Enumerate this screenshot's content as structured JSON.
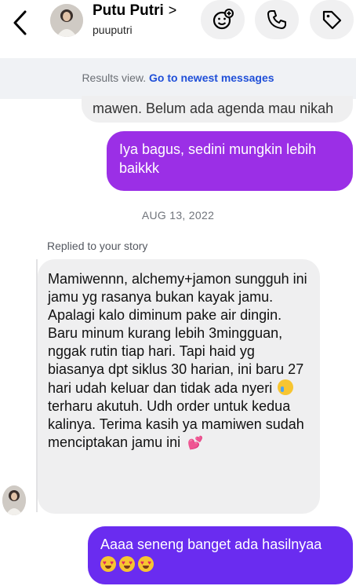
{
  "header": {
    "contact_name": "Putu Putri",
    "name_chevron": ">",
    "username": "puuputri"
  },
  "banner": {
    "text": "Results view.",
    "link": "Go to newest messages"
  },
  "messages": {
    "partial_text": "mawen. Belum ada agenda mau nikah",
    "outgoing_1": "Iya bagus, sedini mungkin lebih baikkk",
    "date_separator": "AUG 13, 2022",
    "replied_label": "Replied to your story",
    "incoming_1": {
      "part1": "Mamiwennn, alchemy+jamon sungguh ini jamu yg rasanya bukan kayak jamu. Apalagi kalo diminum pake air dingin. Baru minum kurang lebih 3mingguan, nggak rutin tiap hari. Tapi haid yg biasanya dpt siklus 30 harian, ini baru 27 hari udah keluar dan tidak ada nyeri",
      "part2": "terharu akutuh. Udh order untuk kedua kalinya. Terima kasih ya mamiwen sudah menciptakan jamu ini",
      "emoji_1": "crying-face",
      "emoji_2": "two-hearts"
    },
    "outgoing_2": "Aaaa seneng banget ada hasilnyaa",
    "outgoing_2_emoji": "smiling-face-with-heart-eyes",
    "outgoing_2_emoji_count": 3
  },
  "colors": {
    "outgoing_bubble_1": "#9b2fe6",
    "outgoing_bubble_2": "#6a2cf0",
    "incoming_bubble": "#efeff0",
    "link": "#1f4fd8"
  }
}
